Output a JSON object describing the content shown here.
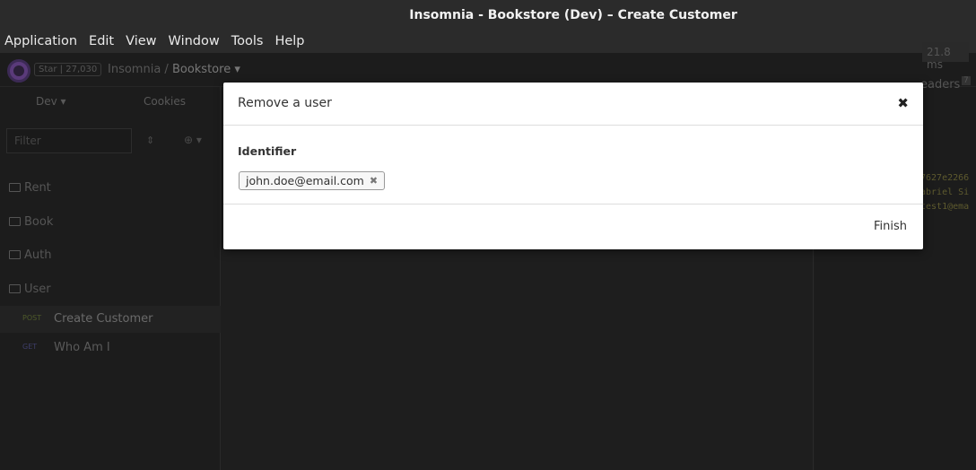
{
  "window": {
    "title": "Insomnia - Bookstore (Dev) – Create Customer"
  },
  "menu": [
    "Application",
    "Edit",
    "View",
    "Window",
    "Tools",
    "Help"
  ],
  "topbar": {
    "star_label": "Star | 27,030",
    "crumb_root": "Insomnia",
    "crumb_sep": "/",
    "crumb_current": "Bookstore ▾"
  },
  "sidebar": {
    "environment": "Dev ▾",
    "cookies": "Cookies",
    "filter_placeholder": "Filter",
    "sort_icon": "⇕",
    "add_icon": "⊕ ▾",
    "folders": [
      "Rent",
      "Book",
      "Auth",
      "User"
    ],
    "requests": [
      {
        "method": "POST",
        "name": "Create Customer",
        "method_color": "#4e5a2a"
      },
      {
        "method": "GET",
        "name": "Who Am I",
        "method_color": "#3e3e6a"
      }
    ]
  },
  "response": {
    "timing": "21.8 ms",
    "headers_label": "eaders",
    "headers_count": "7",
    "code_lines": [
      "7627e2266",
      "abriel Si",
      "test1@ema"
    ]
  },
  "modal": {
    "title": "Remove a user",
    "field_label": "Identifier",
    "tag_value": "john.doe@email.com",
    "tag_remove": "✖",
    "close": "✖",
    "finish_label": "Finish"
  }
}
